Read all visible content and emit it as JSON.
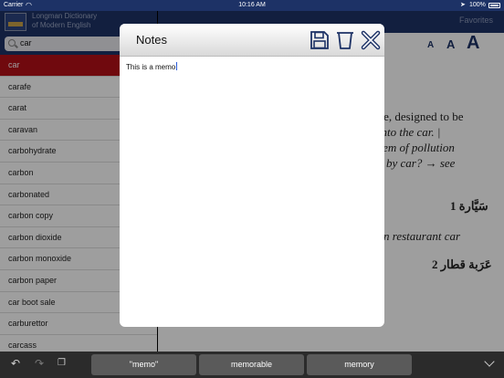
{
  "status": {
    "carrier": "Carrier",
    "time": "10:16 AM",
    "battery": "100%"
  },
  "app": {
    "title": "Longman Dictionary\nof Modern English"
  },
  "search": {
    "query": "car"
  },
  "wordlist": [
    "car",
    "carafe",
    "carat",
    "caravan",
    "carbohydrate",
    "carbon",
    "carbonated",
    "carbon copy",
    "carbon dioxide",
    "carbon monoxide",
    "carbon paper",
    "car boot sale",
    "carburettor",
    "carcass"
  ],
  "selected_index": 0,
  "header": {
    "favorites": "Favorites"
  },
  "font_size": {
    "small": "A",
    "medium": "A",
    "large": "A"
  },
  "entry": {
    "line1": "ine, designed to be",
    "line2": "got into the car.  |",
    "line3": "blem of pollution",
    "line4": "by car? → see",
    "arabic1": "1 سَيَّارة",
    "line5": "n restaurant car",
    "arabic2": "2 عَرَبة قطار"
  },
  "notes": {
    "title": "Notes",
    "memo_text": "This is a memo"
  },
  "keyboard": {
    "suggestions": [
      "\"memo\"",
      "memorable",
      "memory"
    ]
  },
  "colors": {
    "navy": "#1d3266",
    "selected": "#b50f17",
    "keyboard": "#2b2b2b"
  }
}
